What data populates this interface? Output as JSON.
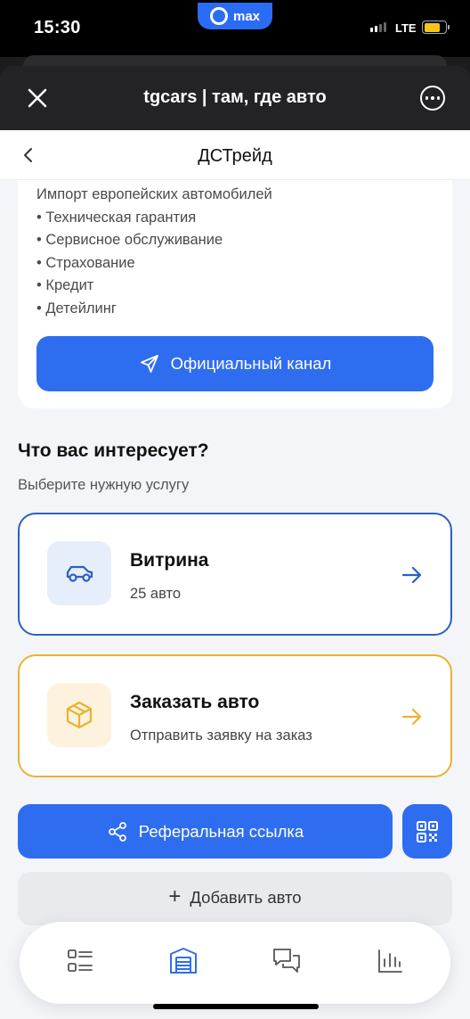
{
  "status_bar": {
    "time": "15:30",
    "carrier_badge": "max",
    "network": "LTE",
    "battery_level": 0.75,
    "signal_bars": 2
  },
  "header": {
    "title": "tgcars | там, где авто",
    "close_icon": "close-icon",
    "more_icon": "more-icon"
  },
  "nav": {
    "title": "ДСТрейд",
    "back_icon": "chevron-left-icon"
  },
  "info": {
    "lines": [
      "Импорт европейских автомобилей",
      "• Техническая гарантия",
      "• Сервисное обслуживание",
      "• Страхование",
      "• Кредит",
      "• Детейлинг"
    ],
    "channel_button": "Официальный канал"
  },
  "section": {
    "title": "Что вас интересует?",
    "subtitle": "Выберите нужную услугу"
  },
  "services": [
    {
      "title": "Витрина",
      "subtitle": "25 авто",
      "icon": "car-icon",
      "color": "#2d5fc4"
    },
    {
      "title": "Заказать авто",
      "subtitle": "Отправить заявку на заказ",
      "icon": "box-icon",
      "color": "#eab233"
    }
  ],
  "referral_button": "Реферальная ссылка",
  "add_button": {
    "icon": "+",
    "label": "Добавить авто"
  },
  "tabs": [
    {
      "name": "list-icon",
      "active": false
    },
    {
      "name": "garage-icon",
      "active": true
    },
    {
      "name": "chat-icon",
      "active": false
    },
    {
      "name": "stats-icon",
      "active": false
    }
  ],
  "colors": {
    "accent": "#2f6df0",
    "showcase_border": "#2d5fc4",
    "order_border": "#eab233"
  }
}
